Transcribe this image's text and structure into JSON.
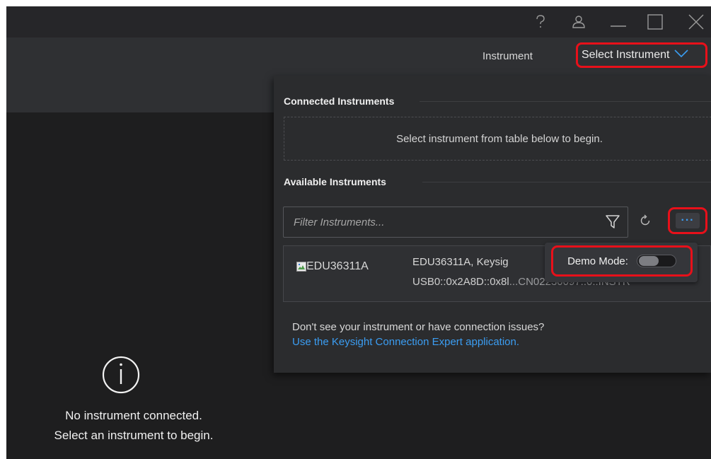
{
  "window_controls": {
    "help_icon": "question-mark",
    "user_icon": "user-outline",
    "minimize_icon": "minimize-line",
    "maximize_icon": "square-outline",
    "close_icon": "x-mark"
  },
  "toolbar": {
    "instrument_label": "Instrument",
    "select_instrument_label": "Select Instrument"
  },
  "left_pane": {
    "message_line1": "No instrument connected.",
    "message_line2": "Select an instrument to begin."
  },
  "panel": {
    "connected_title": "Connected Instruments",
    "connected_empty": "Select instrument from table below to begin.",
    "available_title": "Available Instruments",
    "filter_placeholder": "Filter Instruments...",
    "more_label": "···",
    "instruments": [
      {
        "image_alt": "EDU36311A",
        "line1": "EDU36311A, Keysig",
        "line2": "USB0::0x2A8D::0x8l",
        "line2_tail": "...CN02230097..0..INSTR"
      }
    ],
    "demo_mode_label": "Demo Mode:",
    "demo_mode_on": false,
    "help_text": "Don't see your instrument or have connection issues?",
    "help_link": "Use the Keysight Connection Expert application."
  },
  "colors": {
    "accent_blue": "#3b9df2",
    "highlight_red": "#e8101a",
    "background": "#1e1e1f",
    "panel": "#2b2c2e"
  }
}
